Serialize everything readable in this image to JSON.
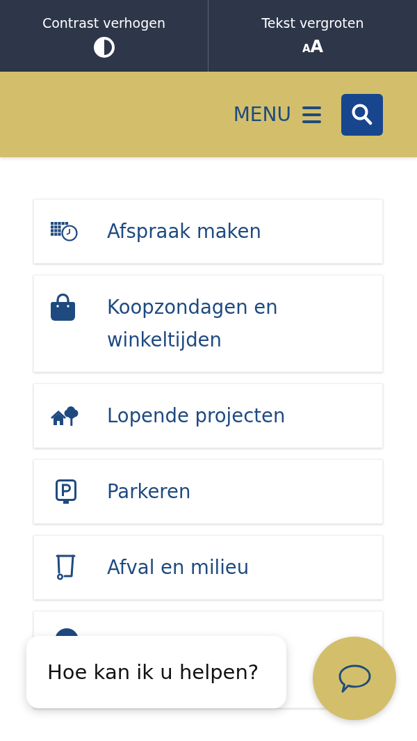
{
  "accessibility_bar": [
    {
      "kind": "contrast",
      "label": "Contrast verhogen"
    },
    {
      "kind": "text_size",
      "label": "Tekst vergroten",
      "icon_letters": [
        "A",
        "A"
      ]
    }
  ],
  "header": {
    "menu_label": "MENU"
  },
  "quick_links": [
    {
      "kind": "calendar_clock",
      "label": "Afspraak maken"
    },
    {
      "kind": "bag",
      "label": "Koopzondagen en winkeltijden"
    },
    {
      "kind": "house_tree",
      "label": "Lopende projecten"
    },
    {
      "kind": "parking",
      "label": "Parkeren"
    },
    {
      "kind": "bin",
      "label": "Afval en milieu"
    },
    {
      "kind": "round"
    }
  ],
  "chat": {
    "prompt": "Hoe kan ik u helpen?"
  }
}
